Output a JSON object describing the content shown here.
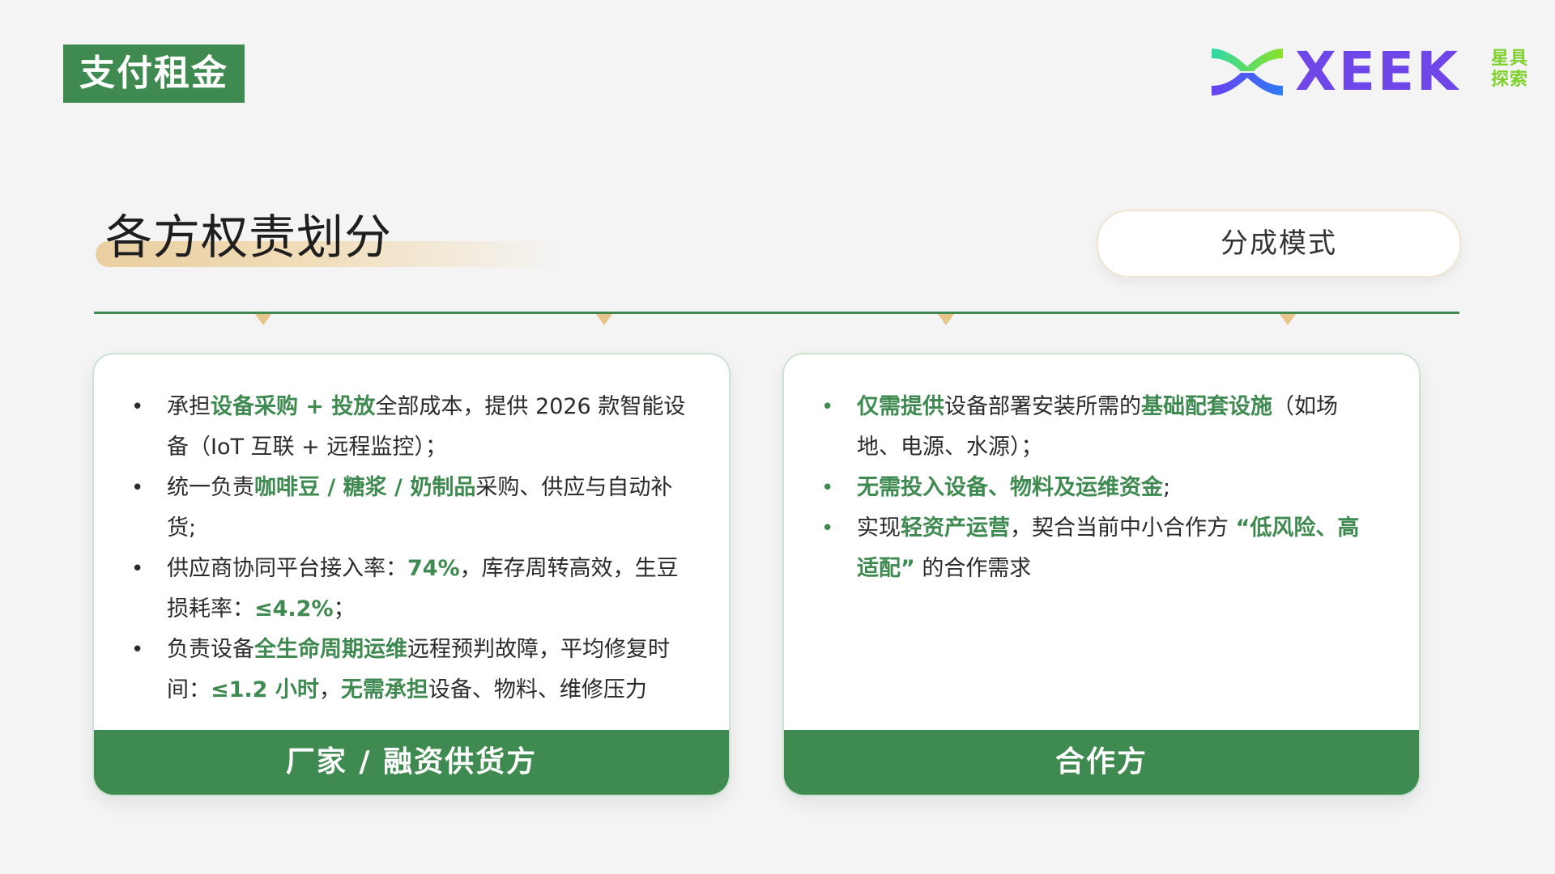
{
  "header": {
    "tag": "支付租金",
    "logo_word": "XEEK",
    "logo_cn": "星具探索"
  },
  "section": {
    "title": "各方权责划分",
    "pill": "分成模式"
  },
  "cards": {
    "left": {
      "footer": "厂家 / 融资供货方",
      "items": [
        {
          "bullet": "•",
          "segments": [
            {
              "text": "承担",
              "hl": false
            },
            {
              "text": "设备采购 + 投放",
              "hl": true
            },
            {
              "text": "全部成本，提供 2026 款智能设备（IoT 互联 + 远程监控）；",
              "hl": false
            }
          ]
        },
        {
          "bullet": "•",
          "segments": [
            {
              "text": "统一负责",
              "hl": false
            },
            {
              "text": "咖啡豆 / 糖浆 / 奶制品",
              "hl": true
            },
            {
              "text": "采购、供应与自动补货;",
              "hl": false
            }
          ]
        },
        {
          "bullet": "•",
          "segments": [
            {
              "text": "供应商协同平台接入率：",
              "hl": false
            },
            {
              "text": "74%",
              "hl": true
            },
            {
              "text": "，库存周转高效，生豆损耗率：",
              "hl": false
            },
            {
              "text": "≤4.2%",
              "hl": true
            },
            {
              "text": "；",
              "hl": false
            }
          ]
        },
        {
          "bullet": "•",
          "segments": [
            {
              "text": "负责设备",
              "hl": false
            },
            {
              "text": "全生命周期运维",
              "hl": true
            },
            {
              "text": "远程预判故障，平均修复时间：",
              "hl": false
            },
            {
              "text": "≤1.2 小时",
              "hl": true
            },
            {
              "text": "，",
              "hl": false
            },
            {
              "text": "无需承担",
              "hl": true
            },
            {
              "text": "设备、物料、维修压力",
              "hl": false
            }
          ]
        }
      ]
    },
    "right": {
      "footer": "合作方",
      "items": [
        {
          "bullet": "•",
          "segments": [
            {
              "text": "仅需提供",
              "hl": true
            },
            {
              "text": "设备部署安装所需的",
              "hl": false
            },
            {
              "text": "基础配套设施",
              "hl": true
            },
            {
              "text": "（如场地、电源、水源）；",
              "hl": false
            }
          ]
        },
        {
          "bullet": "•",
          "segments": [
            {
              "text": "无需投入设备、物料及运维资金",
              "hl": true
            },
            {
              "text": ";",
              "hl": false
            }
          ]
        },
        {
          "bullet": "•",
          "segments": [
            {
              "text": "实现",
              "hl": false
            },
            {
              "text": "轻资产运营",
              "hl": true
            },
            {
              "text": "，契合当前中小合作方 ",
              "hl": false
            },
            {
              "text": "“低风险、高适配”",
              "hl": true
            },
            {
              "text": " 的合作需求",
              "hl": false
            }
          ]
        }
      ]
    }
  },
  "colors": {
    "brand_green": "#3f8a50",
    "accent_gold": "#e6c48a",
    "logo_purple": "#6f47e8",
    "logo_lime": "#7fd02d"
  }
}
